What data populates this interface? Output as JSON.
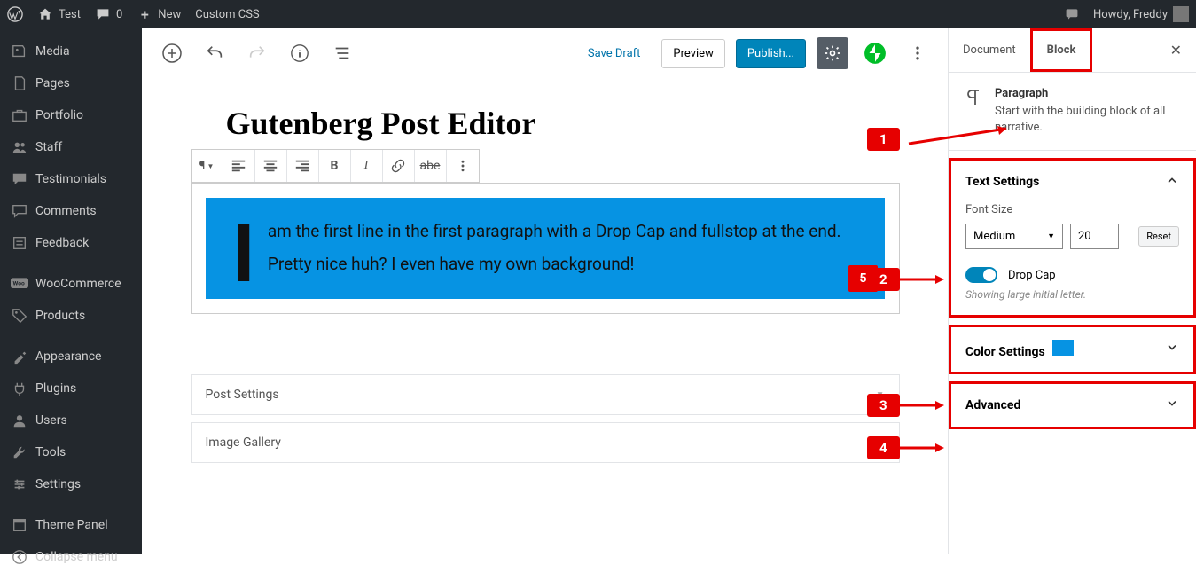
{
  "adminbar": {
    "site": "Test",
    "comments": "0",
    "new": "New",
    "customcss": "Custom CSS",
    "howdy": "Howdy, Freddy"
  },
  "sidebar": [
    {
      "icon": "media",
      "label": "Media"
    },
    {
      "icon": "pages",
      "label": "Pages"
    },
    {
      "icon": "portfolio",
      "label": "Portfolio"
    },
    {
      "icon": "staff",
      "label": "Staff"
    },
    {
      "icon": "testimonials",
      "label": "Testimonials"
    },
    {
      "icon": "comments",
      "label": "Comments"
    },
    {
      "icon": "feedback",
      "label": "Feedback"
    },
    {
      "icon": "woo",
      "label": "WooCommerce"
    },
    {
      "icon": "products",
      "label": "Products"
    },
    {
      "icon": "appearance",
      "label": "Appearance"
    },
    {
      "icon": "plugins",
      "label": "Plugins"
    },
    {
      "icon": "users",
      "label": "Users"
    },
    {
      "icon": "tools",
      "label": "Tools"
    },
    {
      "icon": "settings",
      "label": "Settings"
    },
    {
      "icon": "theme",
      "label": "Theme Panel"
    },
    {
      "icon": "collapse",
      "label": "Collapse menu"
    }
  ],
  "toolbar": {
    "save": "Save Draft",
    "preview": "Preview",
    "publish": "Publish..."
  },
  "post": {
    "title": "Gutenberg Post Editor",
    "dropcap_letter": "I",
    "paragraph": "am the first line in the first paragraph with a Drop Cap and fullstop at the end. Pretty nice huh? I even have my own background!",
    "badge5": "5"
  },
  "accordions": [
    "Post Settings",
    "Image Gallery"
  ],
  "inspector": {
    "tab_document": "Document",
    "tab_block": "Block",
    "block_title": "Paragraph",
    "block_desc": "Start with the building block of all narrative.",
    "text_settings": "Text Settings",
    "font_size_label": "Font Size",
    "font_size_select": "Medium",
    "font_size_value": "20",
    "reset": "Reset",
    "drop_cap": "Drop Cap",
    "drop_cap_hint": "Showing large initial letter.",
    "color_settings": "Color Settings",
    "advanced": "Advanced"
  },
  "callouts": {
    "c1": "1",
    "c2": "2",
    "c3": "3",
    "c4": "4"
  }
}
